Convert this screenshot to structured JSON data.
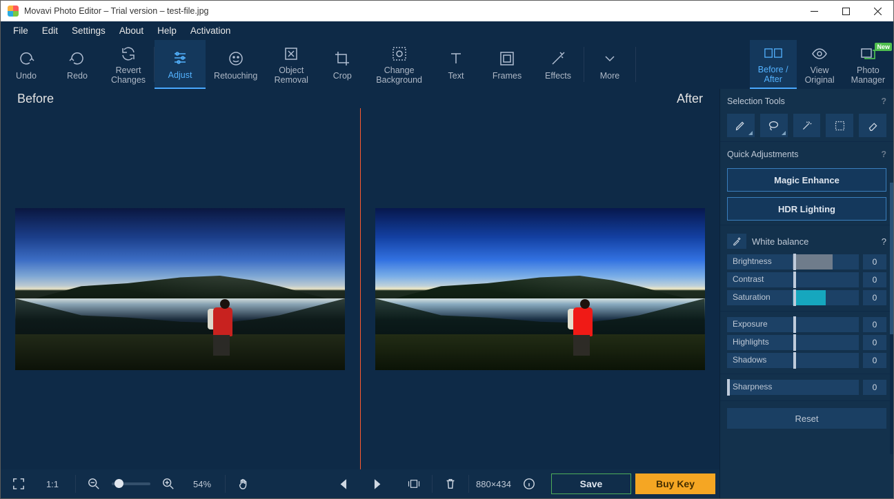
{
  "window": {
    "title": "Movavi Photo Editor – Trial version – test-file.jpg"
  },
  "menubar": [
    "File",
    "Edit",
    "Settings",
    "About",
    "Help",
    "Activation"
  ],
  "toolbar": {
    "undo": "Undo",
    "redo": "Redo",
    "revert": "Revert\nChanges",
    "adjust": "Adjust",
    "retouching": "Retouching",
    "object_removal": "Object\nRemoval",
    "crop": "Crop",
    "change_bg": "Change\nBackground",
    "text": "Text",
    "frames": "Frames",
    "effects": "Effects",
    "more": "More",
    "before_after": "Before /\nAfter",
    "view_original": "View\nOriginal",
    "photo_manager": "Photo\nManager",
    "new_badge": "New"
  },
  "canvas": {
    "before": "Before",
    "after": "After"
  },
  "side": {
    "selection_tools": "Selection Tools",
    "quick_adjust": "Quick Adjustments",
    "magic_enhance": "Magic Enhance",
    "hdr": "HDR Lighting",
    "white_balance": "White balance",
    "sliders": {
      "brightness": {
        "label": "Brightness",
        "value": "0"
      },
      "contrast": {
        "label": "Contrast",
        "value": "0"
      },
      "saturation": {
        "label": "Saturation",
        "value": "0"
      },
      "exposure": {
        "label": "Exposure",
        "value": "0"
      },
      "highlights": {
        "label": "Highlights",
        "value": "0"
      },
      "shadows": {
        "label": "Shadows",
        "value": "0"
      },
      "sharpness": {
        "label": "Sharpness",
        "value": "0"
      }
    },
    "reset": "Reset"
  },
  "bottom": {
    "fit": "1:1",
    "zoom": "54%",
    "dimensions": "880×434",
    "save": "Save",
    "buy": "Buy Key"
  }
}
